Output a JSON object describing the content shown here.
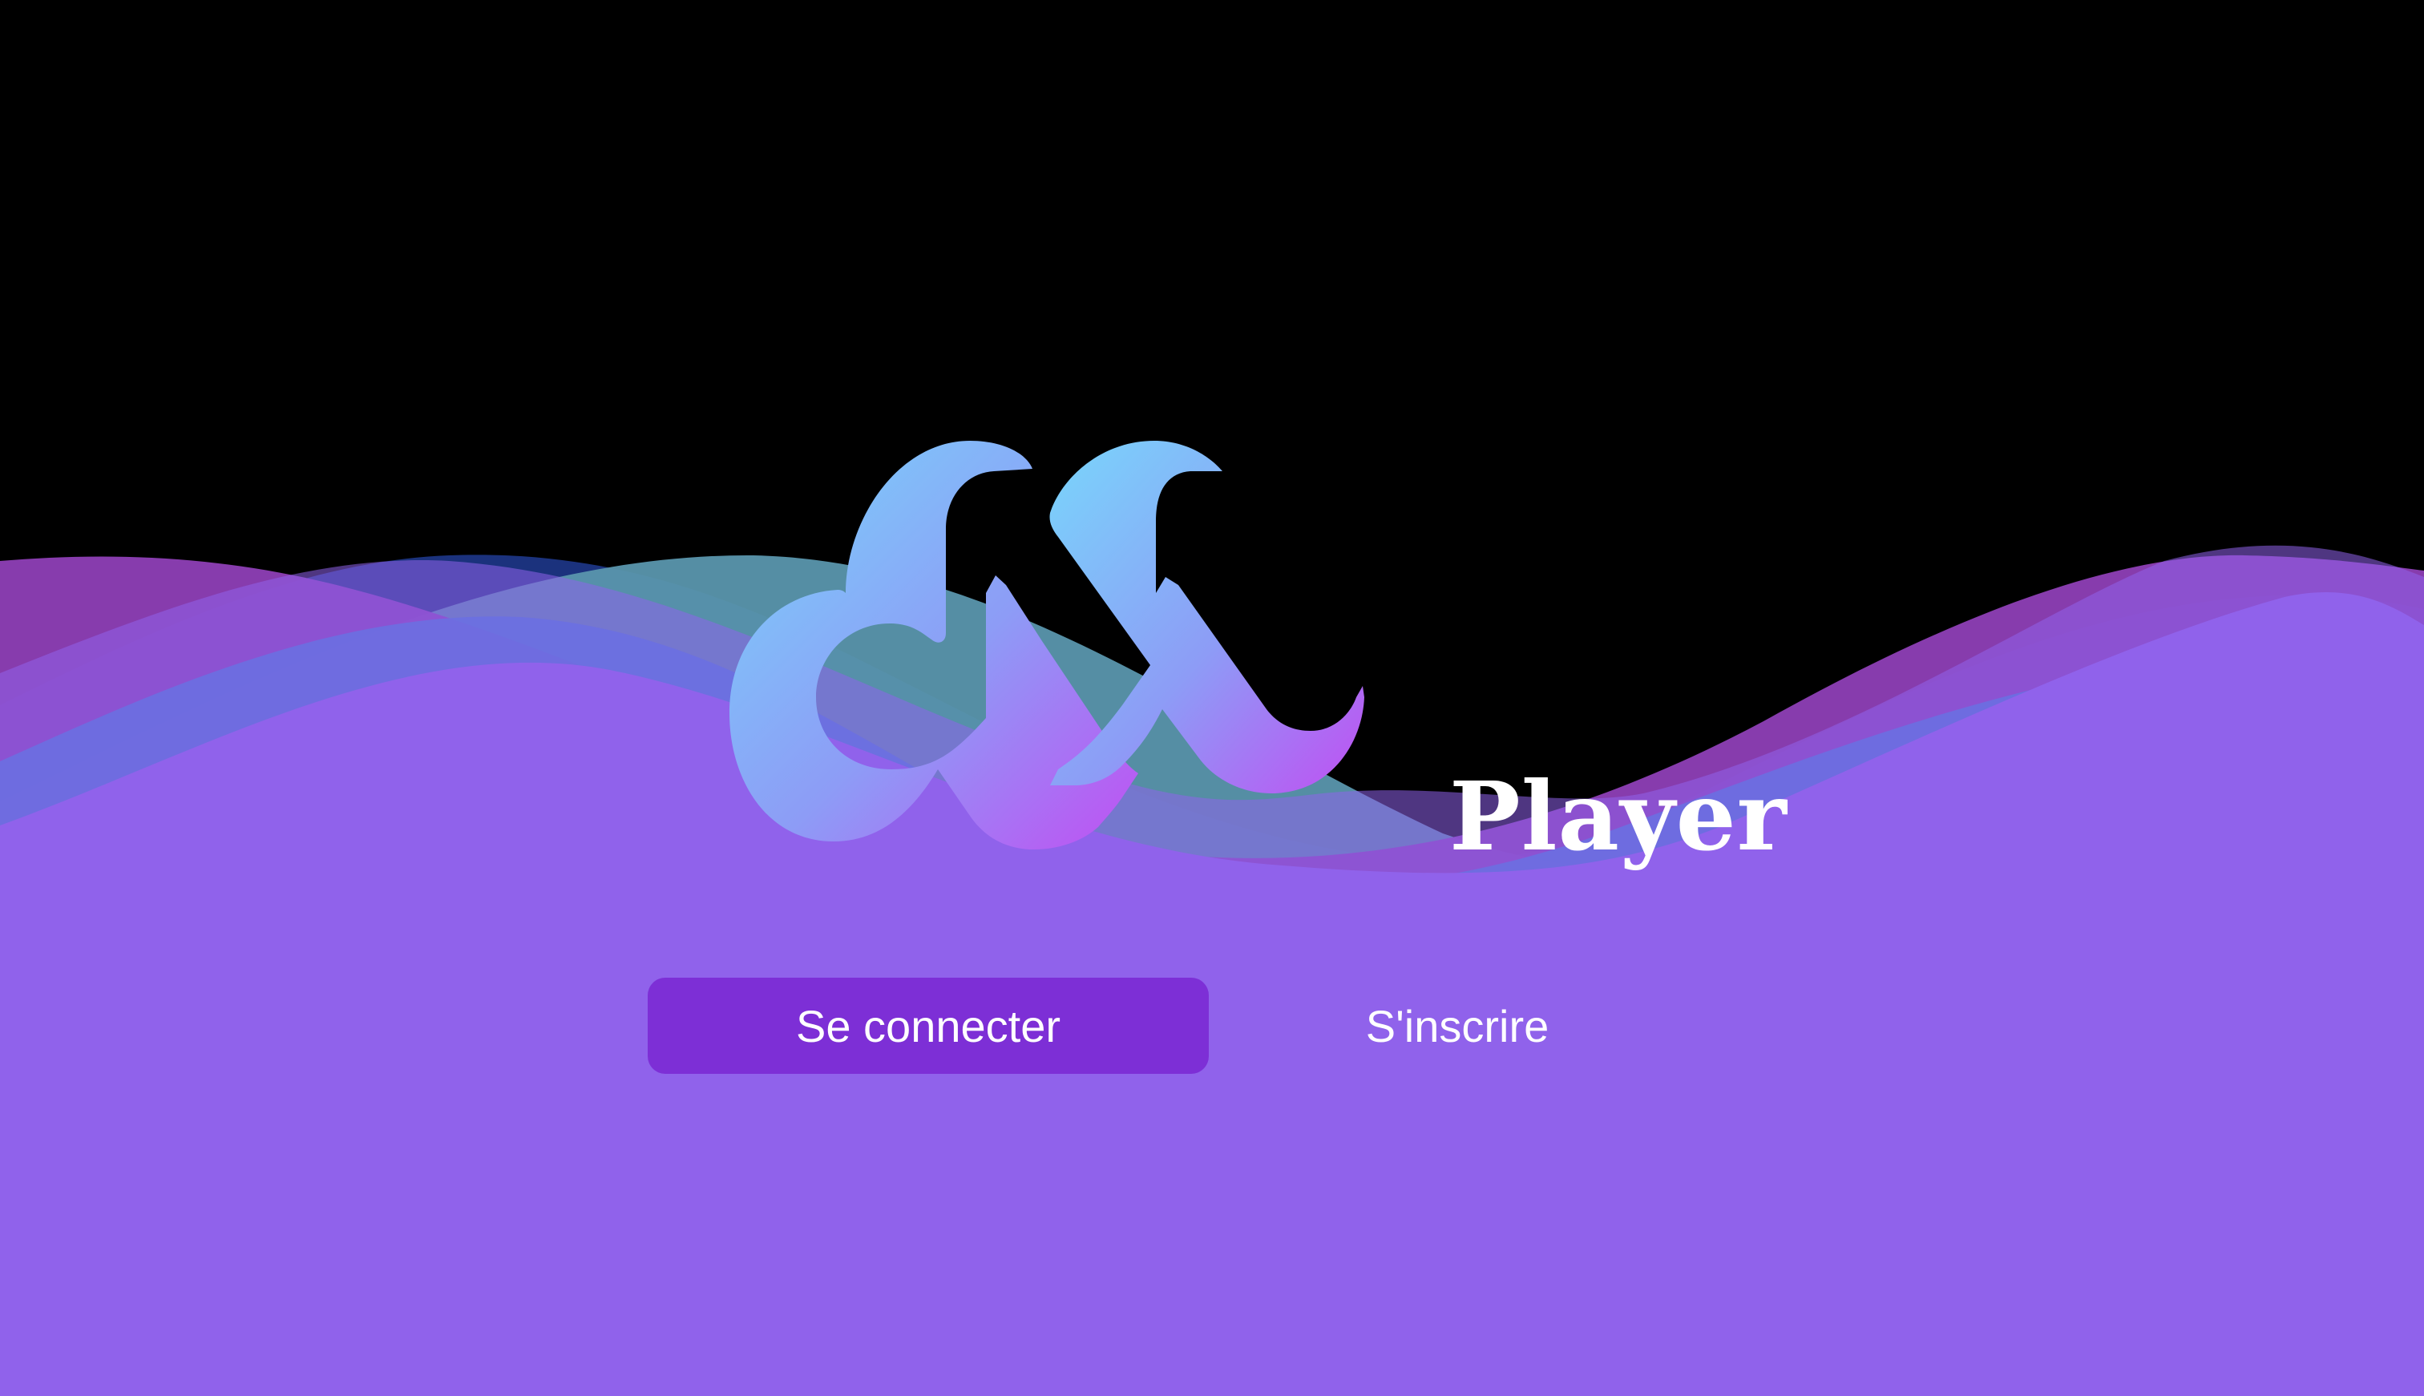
{
  "brand": {
    "name": "Player",
    "logo_icon": "wave-mn-logo"
  },
  "colors": {
    "background_top": "#000000",
    "background_bottom": "#9063eb",
    "wave_magenta": "#8e3fb6",
    "wave_navy": "#1c3584",
    "wave_teal": "#5a96ad",
    "wave_blue": "#3f7ed6",
    "logo_gradient_start": "#79d6fb",
    "logo_gradient_end": "#c04ff2",
    "primary_button": "#7d2fd6",
    "text": "#ffffff"
  },
  "actions": {
    "login_label": "Se connecter",
    "signup_label": "S'inscrire"
  }
}
